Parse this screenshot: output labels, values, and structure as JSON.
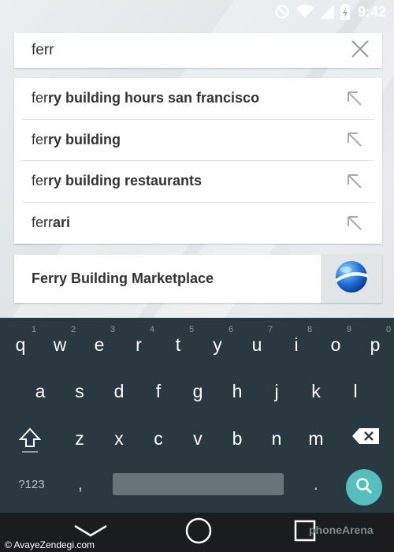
{
  "status_bar": {
    "time": "9:42"
  },
  "search": {
    "value": "ferr"
  },
  "suggestions": [
    {
      "typed": "fer",
      "completion": "ry building hours san francisco"
    },
    {
      "typed": "fer",
      "completion": "ry building"
    },
    {
      "typed": "fer",
      "completion": "ry building restaurants"
    },
    {
      "typed": "ferr",
      "completion": "ari"
    }
  ],
  "place_card": {
    "label": "Ferry Building Marketplace"
  },
  "keyboard": {
    "row1": [
      "q",
      "w",
      "e",
      "r",
      "t",
      "y",
      "u",
      "i",
      "o",
      "p"
    ],
    "row1_hints": [
      "1",
      "2",
      "3",
      "4",
      "5",
      "6",
      "7",
      "8",
      "9",
      "0"
    ],
    "row2": [
      "a",
      "s",
      "d",
      "f",
      "g",
      "h",
      "j",
      "k",
      "l"
    ],
    "row3": [
      "z",
      "x",
      "c",
      "v",
      "b",
      "n",
      "m"
    ],
    "symbols_key": "?123",
    "comma_key": ",",
    "period_key": "."
  },
  "watermarks": {
    "left": "© AvayeZendegi.com",
    "right": "phoneArena"
  },
  "colors": {
    "keyboard_bg": "#29393f",
    "search_key": "#56bfbd"
  }
}
